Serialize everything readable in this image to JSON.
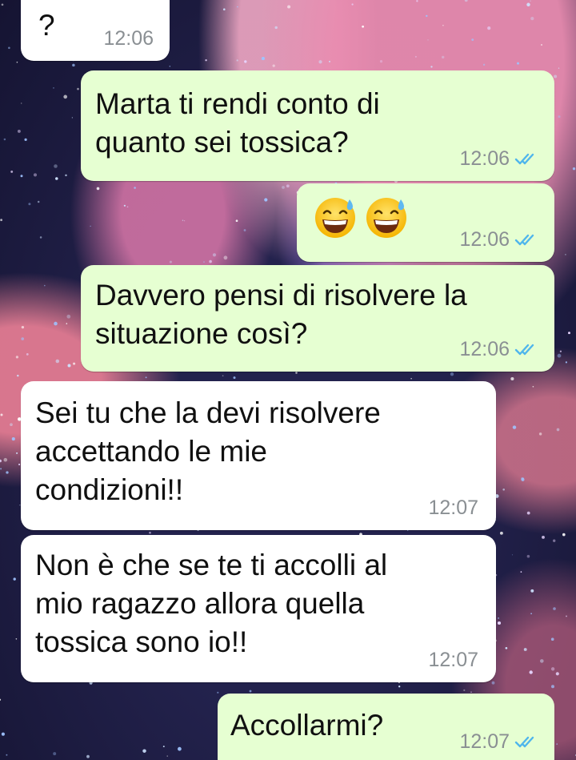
{
  "theme": {
    "incoming_bubble": "#ffffff",
    "outgoing_bubble": "#e6ffd2",
    "tick_color": "#4fb6ec",
    "timestamp_color": "#8a8f93"
  },
  "messages": [
    {
      "direction": "in",
      "text": "?",
      "time": "12:06"
    },
    {
      "direction": "out",
      "text": "Marta ti rendi conto di\nquanto sei tossica?",
      "time": "12:06",
      "status": "read"
    },
    {
      "direction": "out",
      "text": "",
      "emojis": [
        "grinning-face-with-sweat-icon",
        "grinning-face-with-sweat-icon"
      ],
      "time": "12:06",
      "status": "read"
    },
    {
      "direction": "out",
      "text": "Davvero pensi di risolvere la\nsituazione così?",
      "time": "12:06",
      "status": "read"
    },
    {
      "direction": "in",
      "text": "Sei tu che la devi risolvere\naccettando le mie\ncondizioni!!",
      "time": "12:07"
    },
    {
      "direction": "in",
      "text": "Non è che se te ti accolli al\nmio ragazzo allora quella\ntossica sono io!!",
      "time": "12:07"
    },
    {
      "direction": "out",
      "text": "Accollarmi?",
      "time": "12:07",
      "status": "read"
    }
  ]
}
